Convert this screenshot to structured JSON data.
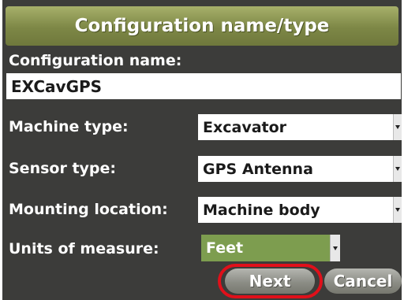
{
  "title": "Configuration name/type",
  "config_name": {
    "label": "Configuration name:",
    "value": "EXCavGPS"
  },
  "machine_type": {
    "label": "Machine type:",
    "value": "Excavator"
  },
  "sensor_type": {
    "label": "Sensor type:",
    "value": "GPS Antenna"
  },
  "mounting_location": {
    "label": "Mounting location:",
    "value": "Machine body"
  },
  "units": {
    "label": "Units of measure:",
    "value": "Feet"
  },
  "buttons": {
    "next": "Next",
    "cancel": "Cancel"
  },
  "colors": {
    "title_bar": "#7d8746",
    "screen_background": "#3c3c3a",
    "selected_dropdown": "#7d9d4f",
    "highlight_ring": "#e0101a"
  },
  "icons": {
    "dropdown_arrow": "chevron-down-icon"
  }
}
